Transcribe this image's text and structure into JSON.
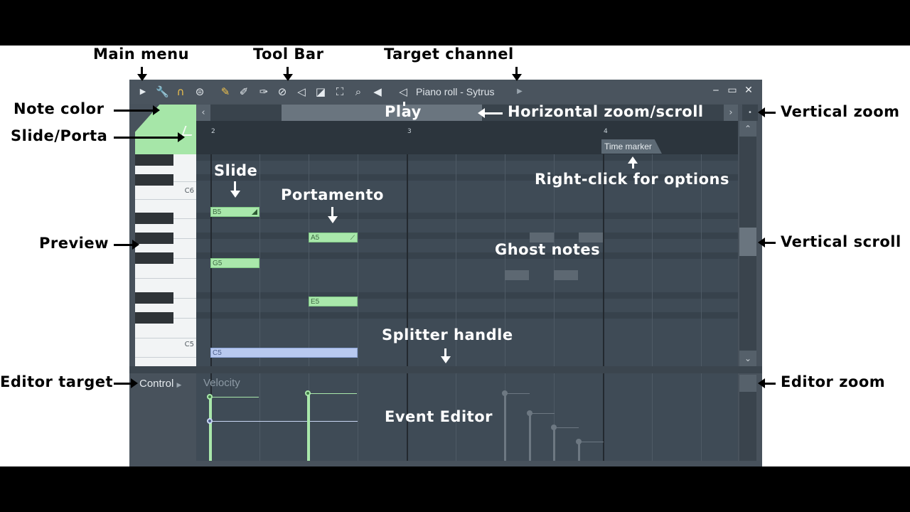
{
  "window": {
    "title": "Piano roll - Sytrus",
    "controls": {
      "minimize": "‒",
      "maximize": "▭",
      "close": "✕"
    }
  },
  "toolbar": {
    "icons": [
      "main-menu-arrow",
      "wrench",
      "magnet",
      "menu-circle",
      "pencil",
      "paint",
      "delete",
      "mute",
      "slice",
      "select",
      "zoom",
      "playback",
      "speaker"
    ]
  },
  "ruler": {
    "bars": [
      "2",
      "3",
      "4"
    ],
    "time_marker": "Time marker"
  },
  "keys": {
    "c6": "C6",
    "c5": "C5"
  },
  "notes": [
    {
      "label": "B5",
      "color": "green",
      "type": "slide"
    },
    {
      "label": "A5",
      "color": "green",
      "type": "porta"
    },
    {
      "label": "G5",
      "color": "green",
      "type": "normal"
    },
    {
      "label": "E5",
      "color": "green",
      "type": "normal"
    },
    {
      "label": "C5",
      "color": "blue",
      "type": "normal"
    }
  ],
  "event_editor": {
    "target": "Control",
    "parameter": "Velocity"
  },
  "annotations": {
    "main_menu": "Main menu",
    "tool_bar": "Tool Bar",
    "target_channel": "Target channel",
    "note_color": "Note color",
    "slide_porta": "Slide/Porta",
    "play": "Play",
    "horizontal_zoom": "Horizontal zoom/scroll",
    "vertical_zoom": "Vertical zoom",
    "slide": "Slide",
    "portamento": "Portamento",
    "right_click": "Right-click for options",
    "preview": "Preview",
    "ghost_notes": "Ghost notes",
    "vertical_scroll": "Vertical scroll",
    "splitter_handle": "Splitter handle",
    "editor_target": "Editor target",
    "event_editor": "Event Editor",
    "editor_zoom": "Editor zoom"
  },
  "colors": {
    "note_green": "#a9e8ab",
    "note_blue": "#b8c9ef",
    "background": "#3f4b56"
  }
}
